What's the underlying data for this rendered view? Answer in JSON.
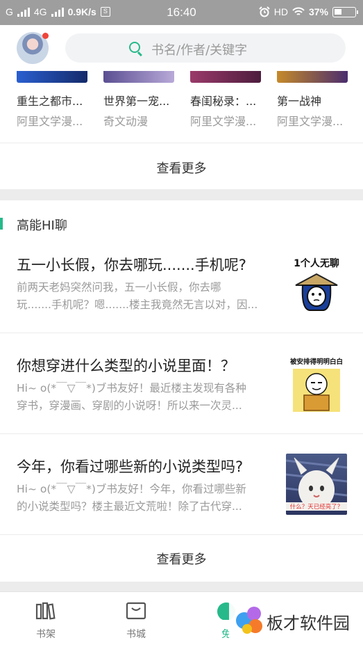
{
  "status_bar": {
    "carrier_g": "G",
    "network_type": "4G",
    "speed": "0.9K/s",
    "sim_icon_glyph": "S",
    "time": "16:40",
    "alarm_icon": "alarm-icon",
    "hd_label": "HD",
    "battery_percent": "37%",
    "battery_level": 0.37
  },
  "header": {
    "search_placeholder": "书名/作者/关键字",
    "accent_color": "#27b98a"
  },
  "book_row": {
    "items": [
      {
        "title": "重生之都市...",
        "author": "阿里文学漫...",
        "cover_color": "#1d3d8a"
      },
      {
        "title": "世界第一宠...",
        "author": "奇文动漫",
        "cover_color": "#7f73b0"
      },
      {
        "title": "春闺秘录：...",
        "author": "阿里文学漫...",
        "cover_color": "#6f2a55"
      },
      {
        "title": "第一战神",
        "author": "阿里文学漫...",
        "cover_color": "#4a2d6e"
      }
    ],
    "more_label": "查看更多"
  },
  "chat_section": {
    "title": "高能HI聊",
    "posts": [
      {
        "title": "五一小长假，你去哪玩.......手机呢?",
        "excerpt_line1": "前两天老妈突然问我，五一小长假，你去哪",
        "excerpt_line2": "玩.......手机呢？嗯.......楼主我竟然无言以对，因...",
        "thumb_caption": "1个人无聊"
      },
      {
        "title": "你想穿进什么类型的小说里面！？",
        "excerpt_line1": "Hi~ o(*￣▽￣*)ブ书友好！最近楼主发现有各种",
        "excerpt_line2": "穿书，穿漫画、穿剧的小说呀！所以来一次灵...",
        "thumb_caption": "被安排得明明白白"
      },
      {
        "title": "今年，你看过哪些新的小说类型吗?",
        "excerpt_line1": "Hi~ o(*￣▽￣*)ブ书友好！今年，你看过哪些新",
        "excerpt_line2": "的小说类型吗？楼主最近文荒啦！除了古代穿...",
        "thumb_caption": "什么？天已经亮了？"
      }
    ],
    "more_label": "查看更多"
  },
  "bottom_nav": {
    "items": [
      {
        "label": "书架",
        "icon": "bookshelf-icon"
      },
      {
        "label": "书城",
        "icon": "bookstore-icon"
      },
      {
        "label": "免",
        "icon": "free-icon"
      }
    ]
  },
  "watermark": {
    "text": "板才软件园"
  }
}
